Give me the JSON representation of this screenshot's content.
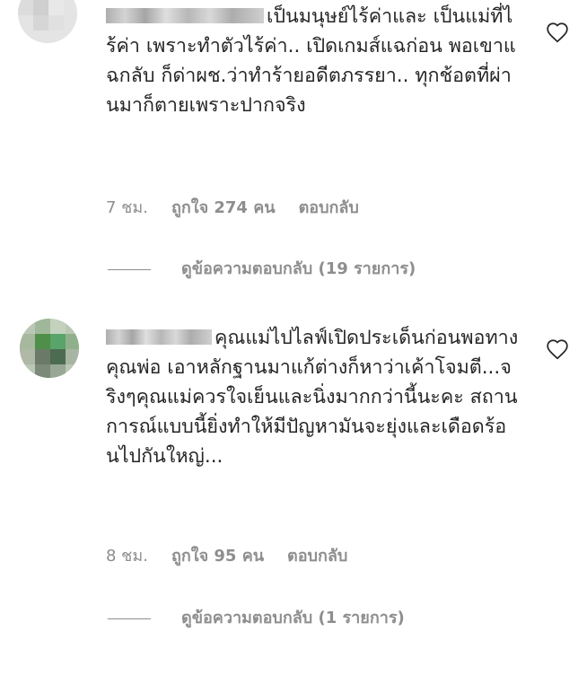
{
  "comments": [
    {
      "text": "เป็นมนุษย์ไร้ค่าและ เป็นแม่ที่ไร้ค่า เพราะทำตัวไร้ค่า.. เปิดเกมส์แฉก่อน พอเขาแฉกลับ ก็ด่าผช.ว่าทำร้ายอดีตภรรยา.. ทุกช้อตที่ผ่านมาก็ตายเพราะปากจริง",
      "time": "7 ชม.",
      "likes": "ถูกใจ 274 คน",
      "reply_label": "ตอบกลับ",
      "view_replies": "ดูข้อความตอบกลับ (19 รายการ)",
      "like_icon": "heart-outline-icon"
    },
    {
      "text": "คุณแม่ไปไลฟ์เปิดประเด็นก่อนพอทางคุณพ่อ เอาหลักฐานมาแก้ต่างก็หาว่าเค้าโจมตี...จริงๆคุณแม่ควรใจเย็นและนิ่งมากกว่านี้นะคะ สถานการณ์แบบนี้ยิ่งทำให้มีปัญหามันจะยุ่งและเดือดร้อนไปกันใหญ่...",
      "time": "8 ชม.",
      "likes": "ถูกใจ 95 คน",
      "reply_label": "ตอบกลับ",
      "view_replies": "ดูข้อความตอบกลับ (1 รายการ)",
      "like_icon": "heart-outline-icon"
    }
  ],
  "colors": {
    "text": "#262626",
    "secondary": "#8e8e8e",
    "background": "#ffffff"
  }
}
